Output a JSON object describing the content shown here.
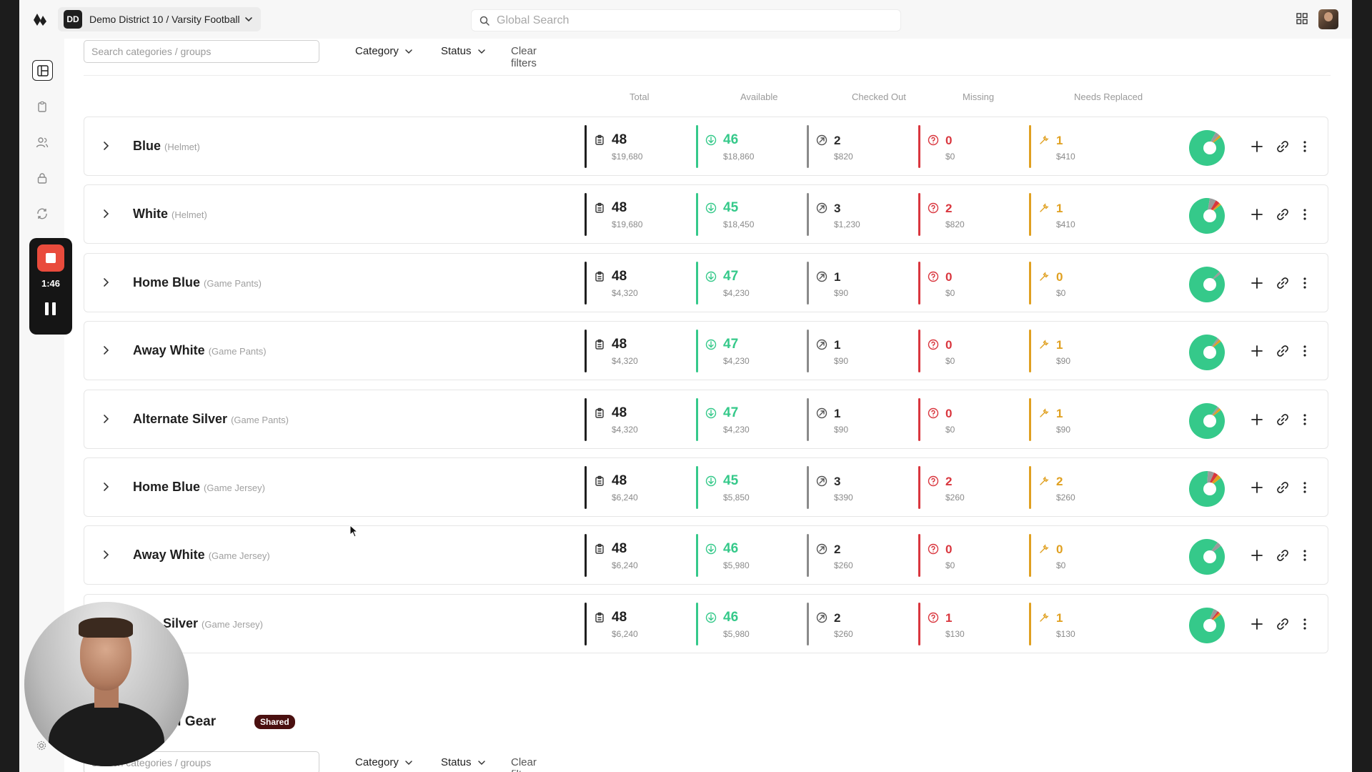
{
  "header": {
    "org_badge": "DD",
    "org_name": "Demo District 10 / Varsity Football",
    "search_placeholder": "Global Search"
  },
  "recorder": {
    "time": "1:46"
  },
  "filters": {
    "search_placeholder": "Search categories / groups",
    "category_label": "Category",
    "status_label": "Status",
    "clear_label": "Clear filters"
  },
  "columns": {
    "total": "Total",
    "available": "Available",
    "checked_out": "Checked Out",
    "missing": "Missing",
    "needs_replaced": "Needs Replaced"
  },
  "colors": {
    "total": "#1f1f1f",
    "available": "#35c98a",
    "checked_out": "#8a8a8a",
    "missing": "#d9363e",
    "needs_replaced": "#e0a020",
    "shared_badge": "#4a1010"
  },
  "rows": [
    {
      "name": "Blue",
      "type": "(Helmet)",
      "total": "48",
      "total_value": "$19,680",
      "available": "46",
      "available_value": "$18,860",
      "checked_out": "2",
      "checked_out_value": "$820",
      "missing": "0",
      "missing_value": "$0",
      "needs_replaced": "1",
      "needs_replaced_value": "$410"
    },
    {
      "name": "White",
      "type": "(Helmet)",
      "total": "48",
      "total_value": "$19,680",
      "available": "45",
      "available_value": "$18,450",
      "checked_out": "3",
      "checked_out_value": "$1,230",
      "missing": "2",
      "missing_value": "$820",
      "needs_replaced": "1",
      "needs_replaced_value": "$410"
    },
    {
      "name": "Home Blue",
      "type": "(Game Pants)",
      "total": "48",
      "total_value": "$4,320",
      "available": "47",
      "available_value": "$4,230",
      "checked_out": "1",
      "checked_out_value": "$90",
      "missing": "0",
      "missing_value": "$0",
      "needs_replaced": "0",
      "needs_replaced_value": "$0"
    },
    {
      "name": "Away White",
      "type": "(Game Pants)",
      "total": "48",
      "total_value": "$4,320",
      "available": "47",
      "available_value": "$4,230",
      "checked_out": "1",
      "checked_out_value": "$90",
      "missing": "0",
      "missing_value": "$0",
      "needs_replaced": "1",
      "needs_replaced_value": "$90"
    },
    {
      "name": "Alternate Silver",
      "type": "(Game Pants)",
      "total": "48",
      "total_value": "$4,320",
      "available": "47",
      "available_value": "$4,230",
      "checked_out": "1",
      "checked_out_value": "$90",
      "missing": "0",
      "missing_value": "$0",
      "needs_replaced": "1",
      "needs_replaced_value": "$90"
    },
    {
      "name": "Home Blue",
      "type": "(Game Jersey)",
      "total": "48",
      "total_value": "$6,240",
      "available": "45",
      "available_value": "$5,850",
      "checked_out": "3",
      "checked_out_value": "$390",
      "missing": "2",
      "missing_value": "$260",
      "needs_replaced": "2",
      "needs_replaced_value": "$260"
    },
    {
      "name": "Away White",
      "type": "(Game Jersey)",
      "total": "48",
      "total_value": "$6,240",
      "available": "46",
      "available_value": "$5,980",
      "checked_out": "2",
      "checked_out_value": "$260",
      "missing": "0",
      "missing_value": "$0",
      "needs_replaced": "0",
      "needs_replaced_value": "$0"
    },
    {
      "name": "nate Silver",
      "type": "(Game Jersey)",
      "total": "48",
      "total_value": "$6,240",
      "available": "46",
      "available_value": "$5,980",
      "checked_out": "2",
      "checked_out_value": "$260",
      "missing": "1",
      "missing_value": "$130",
      "needs_replaced": "1",
      "needs_replaced_value": "$130"
    }
  ],
  "section2": {
    "title_partial": "ll Gear",
    "badge": "Shared",
    "filters": {
      "search_placeholder": "Search categories / groups",
      "category_label": "Category",
      "status_label": "Status",
      "clear_label": "Clear filters"
    }
  }
}
